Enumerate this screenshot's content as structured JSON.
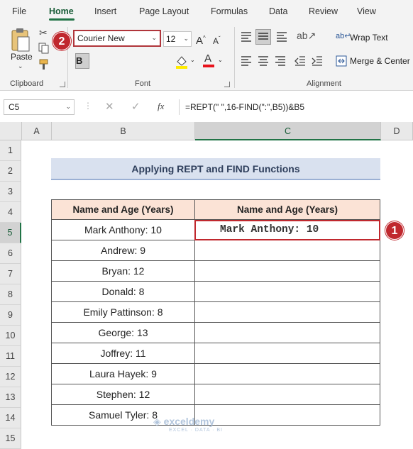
{
  "ribbon": {
    "tabs": [
      "File",
      "Home",
      "Insert",
      "Page Layout",
      "Formulas",
      "Data",
      "Review",
      "View"
    ],
    "active_tab": "Home",
    "clipboard_label": "Clipboard",
    "paste_label": "Paste",
    "font_label": "Font",
    "alignment_label": "Alignment",
    "font_name": "Courier New",
    "font_size": "12",
    "bold_label": "B",
    "wrap_text_label": "Wrap Text",
    "merge_center_label": "Merge & Center"
  },
  "markers": {
    "font_marker": "2",
    "cell_marker": "1"
  },
  "formula_bar": {
    "name_box": "C5",
    "fx": "fx",
    "formula": "=REPT(\" \",16-FIND(\":\",B5))&B5"
  },
  "sheet": {
    "columns": [
      "A",
      "B",
      "C",
      "D"
    ],
    "rows": [
      "1",
      "2",
      "3",
      "4",
      "5",
      "6",
      "7",
      "8",
      "9",
      "10",
      "11",
      "12",
      "13",
      "14",
      "15"
    ],
    "title": "Applying REPT and FIND Functions",
    "header_b": "Name and Age (Years)",
    "header_c": "Name and Age (Years)",
    "names": [
      "Mark Anthony: 10",
      "Andrew: 9",
      "Bryan: 12",
      "Donald: 8",
      "Emily Pattinson: 8",
      "George: 13",
      "Joffrey: 11",
      "Laura Hayek: 9",
      "Stephen: 12",
      "Samuel Tyler: 8"
    ],
    "c5_value": "Mark Anthony: 10"
  },
  "watermark": {
    "name": "exceldemy",
    "tagline": "EXCEL · DATA · BI"
  },
  "colors": {
    "accent": "#217346",
    "marker": "#c0282e",
    "header_fill": "#fbe3d6",
    "title_fill": "#d9e1ef"
  }
}
